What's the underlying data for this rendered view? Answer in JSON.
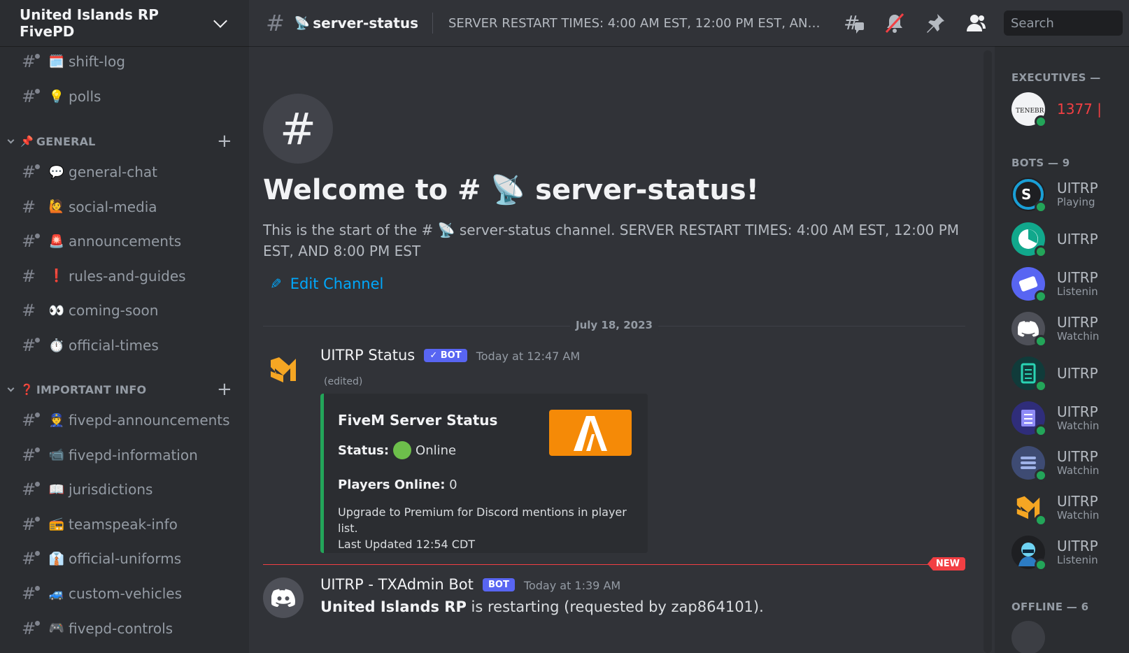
{
  "server": {
    "name": "United Islands RP FivePD"
  },
  "sidebar": {
    "channels_top": [
      {
        "emoji": "🗓️",
        "name": "shift-log",
        "thread": true
      },
      {
        "emoji": "💡",
        "name": "polls",
        "thread": true
      }
    ],
    "categories": [
      {
        "emoji": "📌",
        "label": "GENERAL"
      },
      {
        "emoji": "❓",
        "label": "IMPORTANT INFO"
      }
    ],
    "general_channels": [
      {
        "emoji": "💬",
        "name": "general-chat",
        "thread": true
      },
      {
        "emoji": "🙋",
        "name": "social-media",
        "thread": false
      },
      {
        "emoji": "🚨",
        "name": "announcements",
        "thread": true
      },
      {
        "emoji": "❗",
        "name": "rules-and-guides",
        "thread": false
      },
      {
        "emoji": "👀",
        "name": "coming-soon",
        "thread": false
      },
      {
        "emoji": "⏱️",
        "name": "official-times",
        "thread": true
      }
    ],
    "info_channels": [
      {
        "emoji": "👮",
        "name": "fivepd-announcements",
        "thread": true
      },
      {
        "emoji": "📹",
        "name": "fivepd-information",
        "thread": true
      },
      {
        "emoji": "📖",
        "name": "jurisdictions",
        "thread": true
      },
      {
        "emoji": "📻",
        "name": "teamspeak-info",
        "thread": true
      },
      {
        "emoji": "👔",
        "name": "official-uniforms",
        "thread": true
      },
      {
        "emoji": "🚙",
        "name": "custom-vehicles",
        "thread": true
      },
      {
        "emoji": "🎮",
        "name": "fivepd-controls",
        "thread": true
      }
    ]
  },
  "topbar": {
    "channel_emoji": "📡",
    "channel_name": "server-status",
    "topic": "SERVER RESTART TIMES: 4:00 AM EST, 12:00 PM EST, AND...",
    "search_placeholder": "Search",
    "icons": [
      "threads-icon",
      "mute-bell-icon",
      "pin-icon",
      "members-icon"
    ]
  },
  "welcome": {
    "title": "Welcome to # 📡 server-status!",
    "description": "This is the start of the # 📡 server-status channel. SERVER RESTART TIMES: 4:00 AM EST, 12:00 PM EST, AND 8:00 PM EST",
    "edit_label": "Edit Channel"
  },
  "date_divider": "July 18, 2023",
  "messages": [
    {
      "author": "UITRP Status",
      "bot_tag": "✓ BOT",
      "time": "Today at 12:47 AM",
      "edited": "(edited)",
      "embed": {
        "title": "FiveM Server Status",
        "status_label": "Status:",
        "status_value": "Online",
        "players_label": "Players Online:",
        "players_value": "0",
        "footer_line1": "Upgrade to Premium for Discord mentions in player list.",
        "footer_line2": "Last Updated 12:54 CDT"
      }
    },
    {
      "author": "UITRP - TXAdmin Bot",
      "bot_tag": "BOT",
      "time": "Today at 1:39 AM",
      "text_bold": "United Islands RP",
      "text_rest": " is restarting (requested by zap864101)."
    }
  ],
  "new_label": "NEW",
  "members": {
    "categories": [
      "EXECUTIVES —",
      "BOTS — 9",
      "OFFLINE — 6"
    ],
    "executive": {
      "name": "1377 |",
      "color": "#f23f43"
    },
    "bots": [
      {
        "name": "UITRP",
        "status": "Playing"
      },
      {
        "name": "UITRP",
        "status": ""
      },
      {
        "name": "UITRP",
        "status": "Listenin"
      },
      {
        "name": "UITRP",
        "status": "Watchin"
      },
      {
        "name": "UITRP",
        "status": ""
      },
      {
        "name": "UITRP",
        "status": "Watchin"
      },
      {
        "name": "UITRP",
        "status": "Watchin"
      },
      {
        "name": "UITRP",
        "status": "Watchin"
      },
      {
        "name": "UITRP",
        "status": "Listenin"
      }
    ]
  },
  "colors": {
    "accent": "#5865f2",
    "link": "#00a8fc",
    "online": "#23a559",
    "embed_bar": "#23a559",
    "new_divider": "#f23f43",
    "fivem_orange": "#f58a07"
  }
}
